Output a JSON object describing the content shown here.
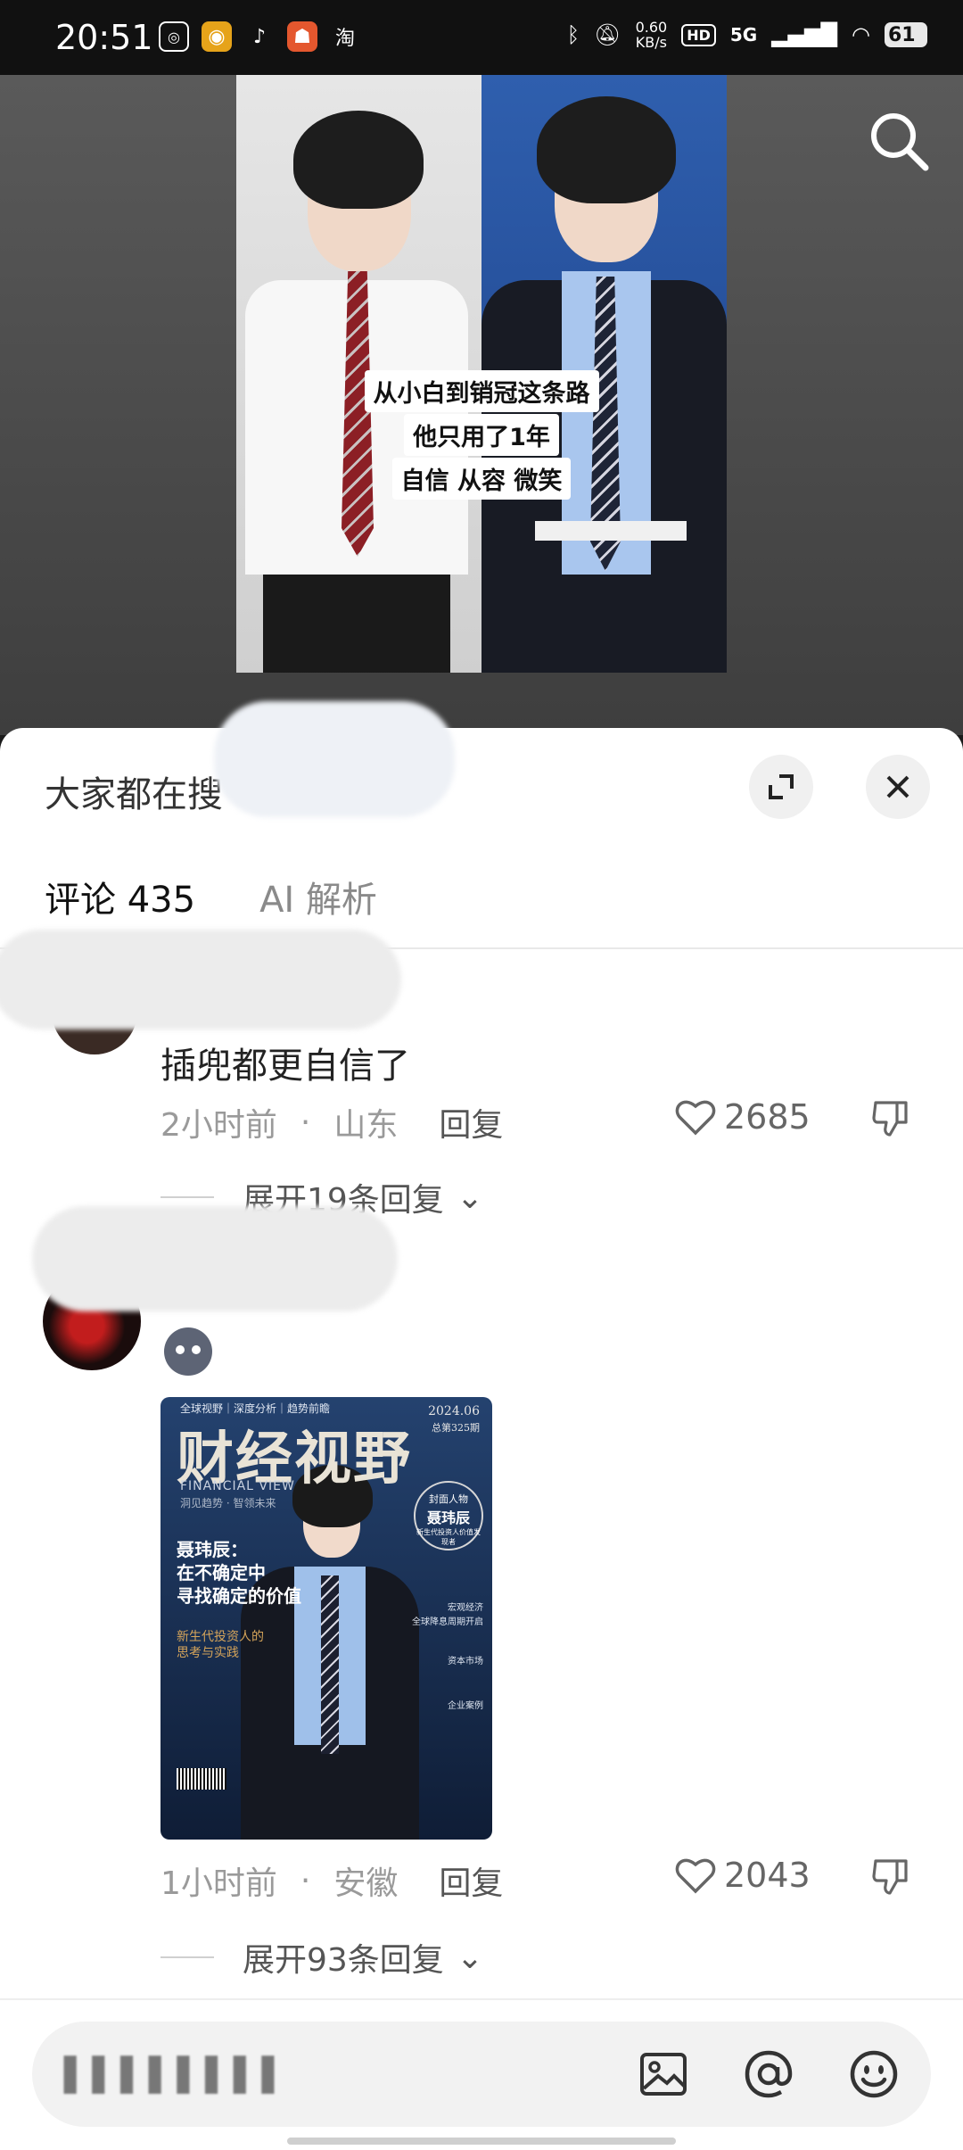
{
  "status_bar": {
    "time": "20:51",
    "app_icons": [
      "weixin-icon",
      "weibo-icon",
      "tiktok-icon",
      "xiaohongshu-icon",
      "taobao-icon"
    ],
    "taobao_label": "淘",
    "net_speed_value": "0.60",
    "net_speed_unit": "KB/s",
    "hd_label": "HD",
    "network": "5G",
    "battery": "61"
  },
  "video": {
    "caption_lines": [
      "从小白到销冠这条路",
      "他只用了1年",
      "自信 从容 微笑"
    ]
  },
  "sheet": {
    "title": "大家都在搜",
    "tabs": [
      {
        "label": "评论 435",
        "active": true
      },
      {
        "label": "AI 解析",
        "active": false
      }
    ]
  },
  "comments": [
    {
      "text": "插兜都更自信了",
      "time": "2小时前",
      "location": "山东",
      "reply_label": "回复",
      "likes": "2685",
      "expand_label": "展开19条回复"
    },
    {
      "image": {
        "top_line": "全球视野｜深度分析｜趋势前瞻",
        "date": "2024.06",
        "issue": "总第325期",
        "title": "财经视野",
        "title_en": "FINANCIAL VIEW",
        "subtitle": "洞见趋势 · 智领未来",
        "badge_top": "封面人物",
        "badge_name": "聂玮辰",
        "badge_sub": "新生代投资人价值发现者",
        "headline": [
          "聂玮辰：",
          "在不确定中",
          "寻找确定的价值"
        ],
        "desc": [
          "新生代投资人的",
          "思考与实践"
        ],
        "side_notes": [
          "宏观经济",
          "全球降息周期开启",
          "资本市场",
          "企业案例"
        ]
      },
      "time": "1小时前",
      "location": "安徽",
      "reply_label": "回复",
      "likes": "2043",
      "expand_label": "展开93条回复"
    }
  ]
}
